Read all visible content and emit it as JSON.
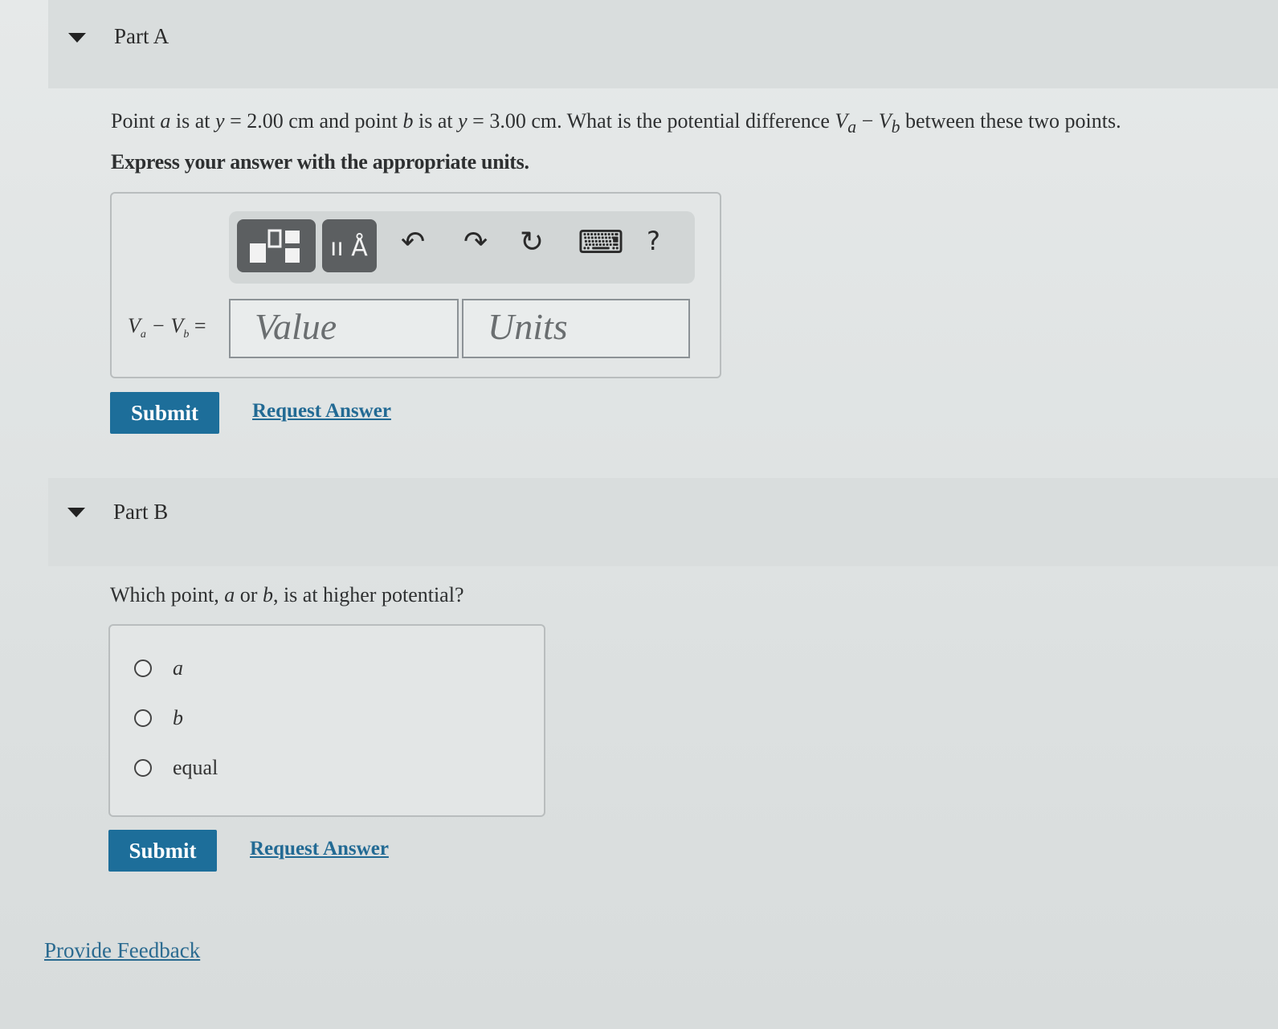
{
  "partA": {
    "title": "Part A",
    "question_prefix": "Point ",
    "q_a": "a",
    "q_mid1": " is at ",
    "q_y1": "y",
    "q_eq1": " = 2.00 cm and point ",
    "q_b": "b",
    "q_mid2": " is at ",
    "q_y2": "y",
    "q_eq2": " = 3.00 cm. What is the potential difference ",
    "q_va": "V",
    "q_va_sub": "a",
    "q_minus": "  −  ",
    "q_vb": "V",
    "q_vb_sub": "b",
    "q_suffix": " between these two points.",
    "instruction": "Express your answer with the appropriate units.",
    "answer_label": "V",
    "answer_label_sub_a": "a",
    "answer_label_mid": " − V",
    "answer_label_sub_b": "b",
    "answer_label_eq": " =",
    "value_placeholder": "Value",
    "units_placeholder": "Units",
    "toolbar": {
      "templates_icon": "templates-icon",
      "units_icon_text": "ıı Å",
      "undo_icon": "↶",
      "redo_icon": "↷",
      "reset_icon": "↻",
      "keyboard_icon": "⌨",
      "help_icon": "?"
    },
    "submit_label": "Submit",
    "request_label": "Request Answer"
  },
  "partB": {
    "title": "Part B",
    "question_prefix": "Which point, ",
    "q_a": "a",
    "q_or": " or ",
    "q_b": "b",
    "q_suffix": ", is at higher potential?",
    "options": [
      "a",
      "b",
      "equal"
    ],
    "submit_label": "Submit",
    "request_label": "Request Answer"
  },
  "feedback_label": "Provide Feedback"
}
